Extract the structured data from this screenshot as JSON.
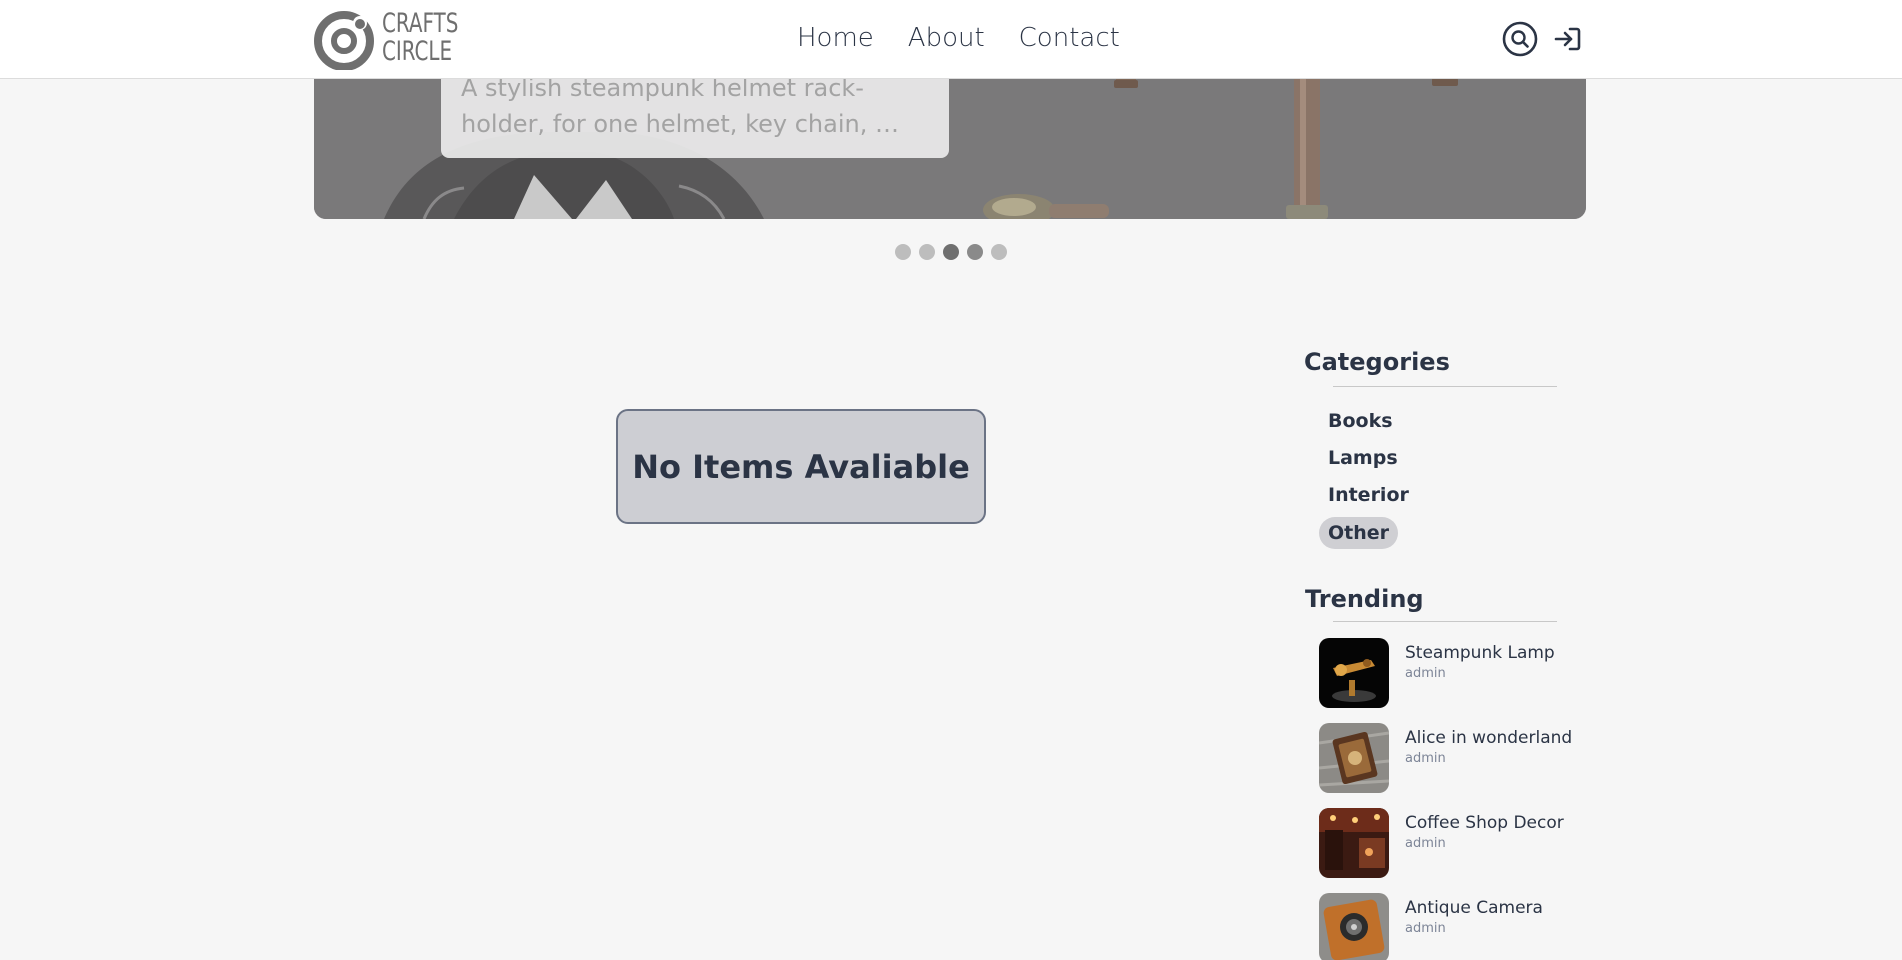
{
  "brand": {
    "line1": "CRAFTS",
    "line2": "CIRCLE"
  },
  "nav": {
    "home": "Home",
    "about": "About",
    "contact": "Contact"
  },
  "hero": {
    "caption": "A stylish steampunk helmet rack-holder, for one helmet, key chain, …",
    "active_slide": 3,
    "slide_count": 5
  },
  "main": {
    "empty_message": "No Items Avaliable"
  },
  "sidebar": {
    "categories_title": "Categories",
    "categories": [
      {
        "label": "Books"
      },
      {
        "label": "Lamps"
      },
      {
        "label": "Interior"
      },
      {
        "label": "Other"
      }
    ],
    "selected_category": "Other",
    "trending_title": "Trending",
    "trending": [
      {
        "title": "Steampunk Lamp",
        "author": "admin"
      },
      {
        "title": "Alice in wonderland",
        "author": "admin"
      },
      {
        "title": "Coffee Shop Decor",
        "author": "admin"
      },
      {
        "title": "Antique Camera",
        "author": "admin"
      }
    ]
  },
  "colors": {
    "text": "#2b3445",
    "page_bg": "#f6f6f6",
    "notice_bg": "#cdced3",
    "notice_border": "#6b7385",
    "selected_pill": "#cfcfd3"
  }
}
